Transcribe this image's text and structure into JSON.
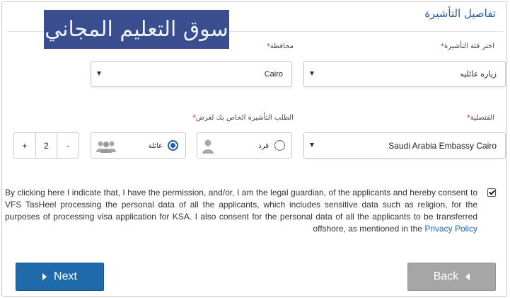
{
  "header": {
    "title": "تفاصيل التأشيرة",
    "logo_text": "سوق التعليم المجاني"
  },
  "form": {
    "visa_category": {
      "label": "اختر فئة التأشيرة",
      "required_mark": "*",
      "value": "زياره عائليه"
    },
    "governorate": {
      "label": "محافظة",
      "required_mark": "*",
      "value": "Cairo"
    },
    "consulate": {
      "label": "القنصلية",
      "required_mark": "*",
      "value": "Saudi Arabia Embassy Cairo"
    },
    "request_type": {
      "label": "الطلب التأشيرة الخاص بك لغرض",
      "required_mark": "*",
      "options": [
        {
          "label": "فرد",
          "selected": false
        },
        {
          "label": "عائلة",
          "selected": true
        }
      ]
    },
    "applicants": {
      "minus": "-",
      "value": "2",
      "plus": "+"
    }
  },
  "consent": {
    "text": "By clicking here I indicate that, I have the permission, and/or, I am the legal guardian, of the applicants and hereby consent to VFS TasHeel processing the personal data of all the applicants, which includes sensitive data such as religion, for the purposes of processing visa application for KSA. I also consent for the personal data of all the applicants to be transferred offshore, as mentioned in the",
    "link_text": "Privacy Policy",
    "checked": true
  },
  "buttons": {
    "next": "Next",
    "back": "Back"
  },
  "colors": {
    "primary": "#1f6aab",
    "disabled": "#a6a6a6",
    "title": "#2b5aa0",
    "required": "#d9322a"
  },
  "icons": [
    "person-icon",
    "group-icon",
    "caret-down-icon",
    "caret-right-icon",
    "caret-left-icon",
    "check-icon"
  ]
}
